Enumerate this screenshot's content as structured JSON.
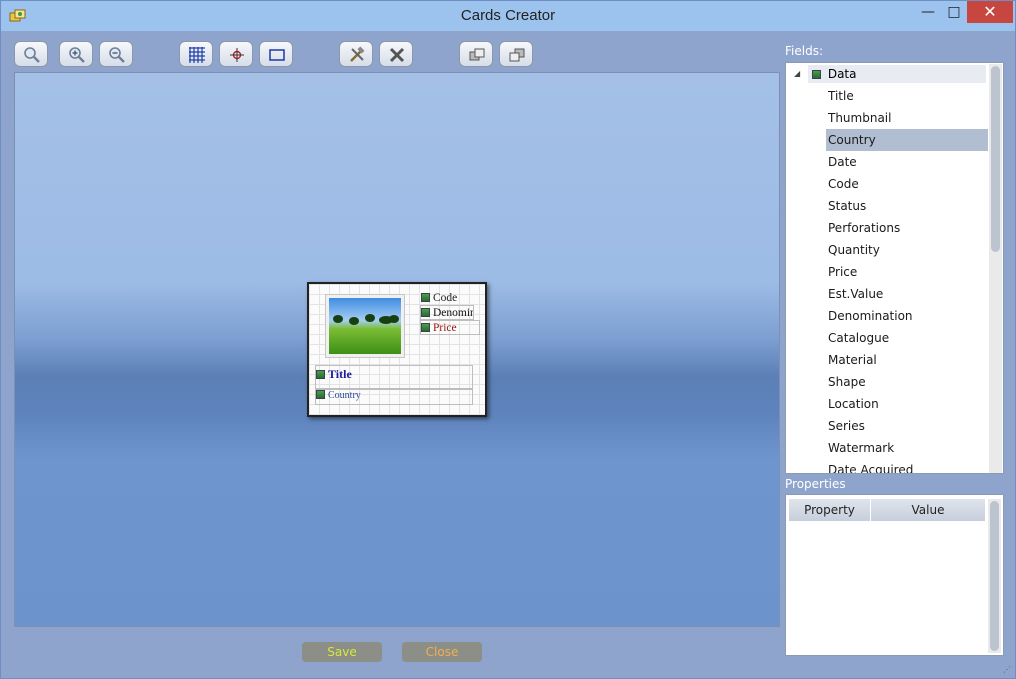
{
  "window": {
    "title": "Cards Creator",
    "minimize": "—",
    "maximize": "□",
    "close": "✕"
  },
  "toolbar": {
    "buttons": [
      {
        "icon": "zoom-fit-icon"
      },
      {
        "icon": "zoom-in-icon"
      },
      {
        "icon": "zoom-out-icon"
      },
      {
        "icon": "grid-icon"
      },
      {
        "icon": "crosshair-icon"
      },
      {
        "icon": "rectangle-icon"
      },
      {
        "icon": "tools-icon"
      },
      {
        "icon": "delete-icon"
      },
      {
        "icon": "bring-front-icon"
      },
      {
        "icon": "send-back-icon"
      }
    ]
  },
  "card": {
    "fields": [
      "Code",
      "Denomination",
      "Price",
      "Title",
      "Country"
    ]
  },
  "actions": {
    "save": "Save",
    "close": "Close"
  },
  "fields_panel": {
    "label": "Fields:",
    "root": "Data",
    "items": [
      "Title",
      "Thumbnail",
      "Country",
      "Date",
      "Code",
      "Status",
      "Perforations",
      "Quantity",
      "Price",
      "Est.Value",
      "Denomination",
      "Catalogue",
      "Material",
      "Shape",
      "Location",
      "Series",
      "Watermark",
      "Date Acquired"
    ],
    "selected": "Country"
  },
  "properties_panel": {
    "label": "Properties",
    "columns": [
      "Property",
      "Value"
    ]
  },
  "colors": {
    "title_bar": "#9cc3ee",
    "window_bg": "#8ea4cd",
    "close_button": "#c7463f",
    "selection": "#b1bdd0",
    "save_text": "#d6e83a",
    "close_text": "#f2b04e"
  }
}
